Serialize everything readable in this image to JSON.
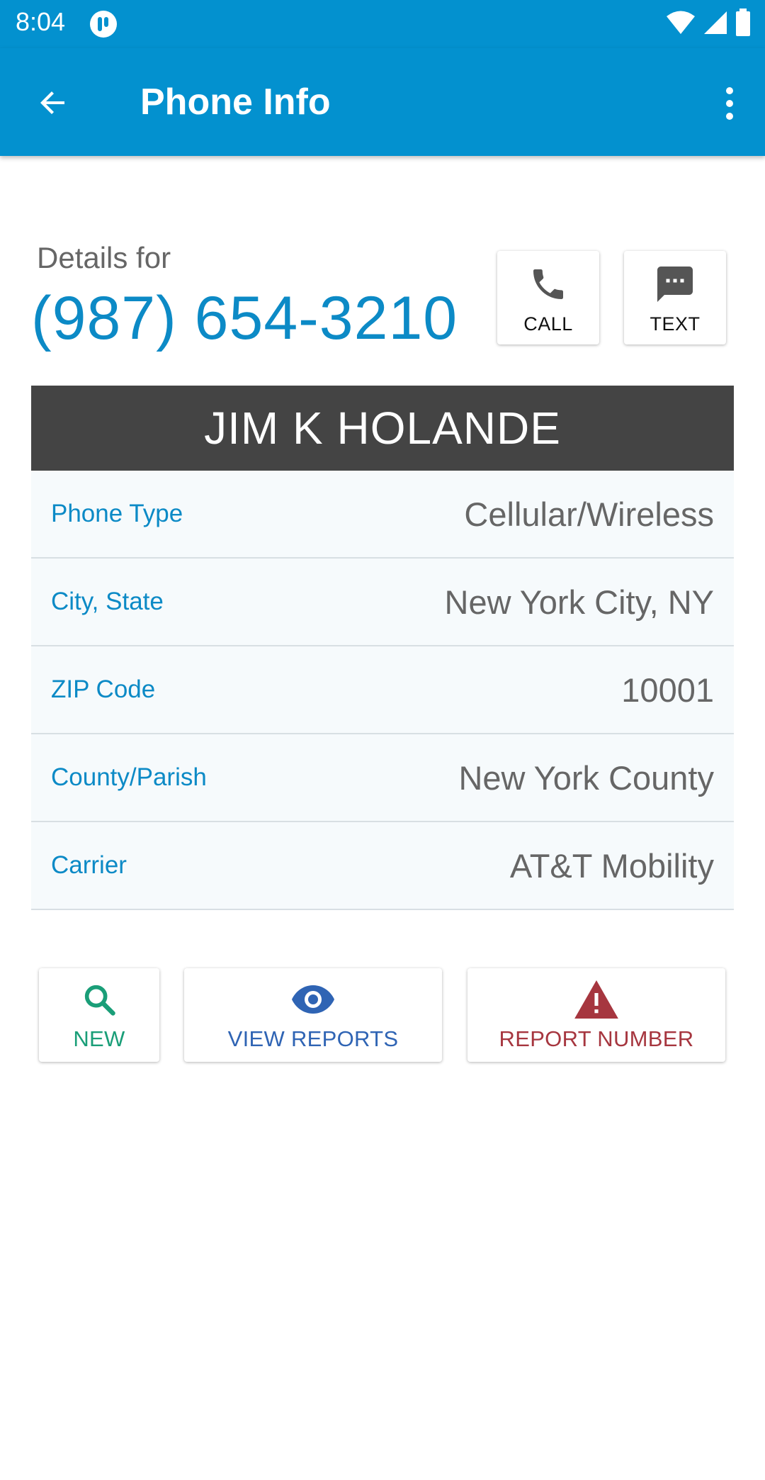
{
  "status": {
    "time": "8:04"
  },
  "appbar": {
    "title": "Phone Info"
  },
  "header": {
    "details_label": "Details for",
    "phone_number": "(987) 654-3210"
  },
  "actions": {
    "call": "CALL",
    "text": "TEXT"
  },
  "owner": {
    "name": "JIM K HOLANDE"
  },
  "info": [
    {
      "label": "Phone Type",
      "value": "Cellular/Wireless"
    },
    {
      "label": "City, State",
      "value": "New York City, NY"
    },
    {
      "label": "ZIP Code",
      "value": "10001"
    },
    {
      "label": "County/Parish",
      "value": "New York County"
    },
    {
      "label": "Carrier",
      "value": "AT&T Mobility"
    }
  ],
  "bottom_actions": {
    "new": {
      "label": "NEW",
      "color": "#1a9e78"
    },
    "view_reports": {
      "label": "VIEW REPORTS",
      "color": "#2f64b4"
    },
    "report_number": {
      "label": "REPORT NUMBER",
      "color": "#a6363f"
    }
  },
  "icons": [
    "wifi-icon",
    "signal-icon",
    "battery-icon",
    "back-arrow-icon",
    "more-vert-icon",
    "phone-icon",
    "message-icon",
    "search-icon",
    "eye-icon",
    "warning-icon"
  ],
  "colors": {
    "primary": "#0391cf",
    "accent_text": "#0c8ac6",
    "banner": "#444444"
  }
}
